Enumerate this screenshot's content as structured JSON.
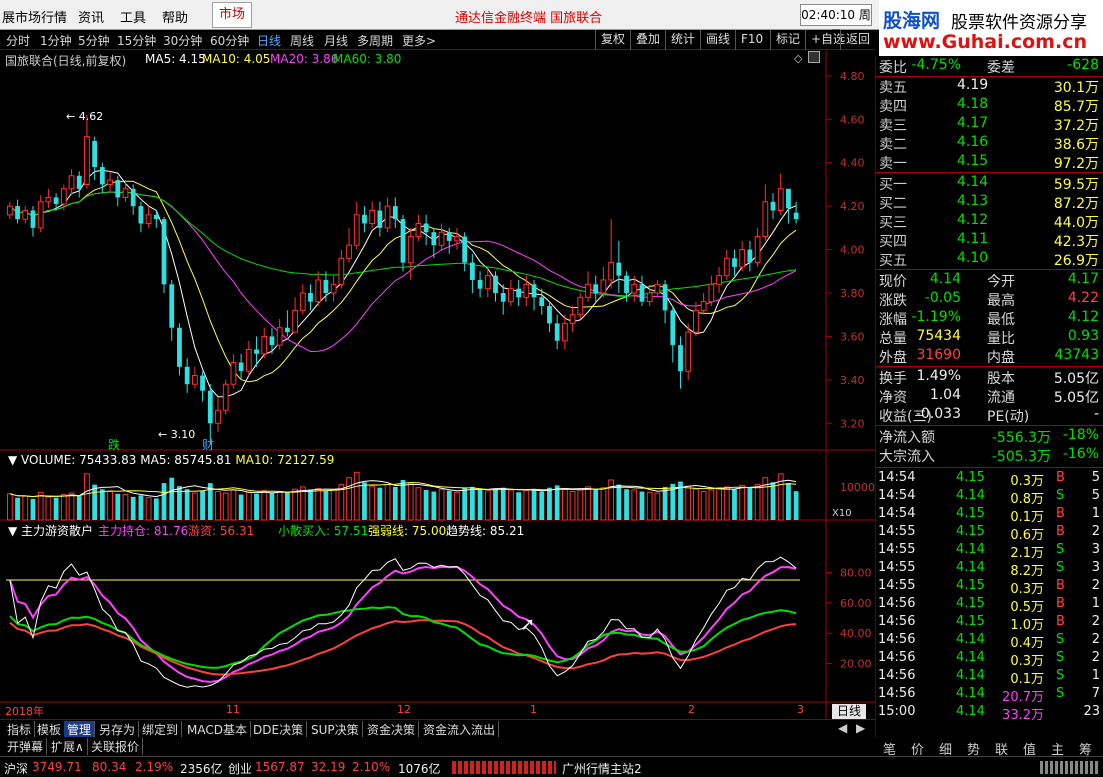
{
  "menubar": {
    "items": [
      "展市场行情",
      "资讯",
      "工具",
      "帮助"
    ],
    "market_tab": "市场",
    "center_title": "通达信金融终端 国旅联合",
    "clock": "02:40:10 周日"
  },
  "brand": {
    "name": "股海网",
    "slogan": "股票软件资源分享",
    "url": "www.Guhai.com.cn"
  },
  "toolbar": {
    "periods": [
      "分时",
      "1分钟",
      "5分钟",
      "15分钟",
      "30分钟",
      "60分钟",
      "日线",
      "周线",
      "月线",
      "多周期",
      "更多>"
    ],
    "active_period": "日线",
    "actions": [
      "复权",
      "叠加",
      "统计",
      "画线",
      "F10",
      "标记",
      "+自选",
      "返回"
    ]
  },
  "main_chart": {
    "title": "国旅联合(日线,前复权)",
    "ma_labels": [
      "MA5: 4.15",
      "MA10: 4.05",
      "MA20: 3.86",
      "MA60: 3.80"
    ],
    "ma_colors": [
      "#ffffff",
      "#ffff40",
      "#ff40ff",
      "#00e000"
    ],
    "high_label": "4.62",
    "low_label": "3.10",
    "marks": [
      "跌",
      "财"
    ],
    "price_axis": [
      "4.80",
      "4.60",
      "4.40",
      "4.20",
      "4.00",
      "3.80",
      "3.60",
      "3.40",
      "3.20"
    ]
  },
  "volume_panel": {
    "title": "VOLUME: 75433.83",
    "ma5": "MA5: 85745.81",
    "ma10": "MA10: 72127.59",
    "axis_label": "10000",
    "unit": "X10"
  },
  "indicator_panel": {
    "name": "主力游资散户",
    "lines": [
      "主力持仓: 81.76",
      "游资: 56.31",
      "小散买入: 57.51",
      "强弱线: 75.00",
      "趋势线: 85.21"
    ],
    "line_colors": [
      "#ff40ff",
      "#ff4040",
      "#00e000",
      "#ffff40",
      "#ffffff"
    ],
    "axis": [
      "80.00",
      "60.00",
      "40.00",
      "20.00"
    ]
  },
  "date_axis": [
    "2018年",
    "11",
    "12",
    "1",
    "2",
    "3"
  ],
  "bottom_tabs": [
    "指标",
    "模板",
    "管理",
    "另存为",
    "绑定到",
    "MACD基本",
    "DDE决策",
    "SUP决策",
    "资金决策",
    "资金流入流出"
  ],
  "bottom_tabs_active": "管理",
  "day_tab": "日线",
  "bottom_tabs2": [
    "开弹幕",
    "扩展∧",
    "关联报价"
  ],
  "side": {
    "weibi": {
      "label": "委比",
      "value": "-4.75%",
      "label2": "委差",
      "value2": "-628"
    },
    "asks": [
      {
        "label": "卖五",
        "price": "4.19",
        "qty": "30.1万"
      },
      {
        "label": "卖四",
        "price": "4.18",
        "qty": "85.7万"
      },
      {
        "label": "卖三",
        "price": "4.17",
        "qty": "37.2万"
      },
      {
        "label": "卖二",
        "price": "4.16",
        "qty": "38.6万"
      },
      {
        "label": "卖一",
        "price": "4.15",
        "qty": "97.2万"
      }
    ],
    "bids": [
      {
        "label": "买一",
        "price": "4.14",
        "qty": "59.5万"
      },
      {
        "label": "买二",
        "price": "4.13",
        "qty": "87.2万"
      },
      {
        "label": "买三",
        "price": "4.12",
        "qty": "44.0万"
      },
      {
        "label": "买四",
        "price": "4.11",
        "qty": "42.3万"
      },
      {
        "label": "买五",
        "price": "4.10",
        "qty": "26.9万"
      }
    ],
    "quote": [
      {
        "l": "现价",
        "v": "4.14",
        "l2": "今开",
        "v2": "4.17",
        "c": "grn",
        "c2": "grn"
      },
      {
        "l": "涨跌",
        "v": "-0.05",
        "l2": "最高",
        "v2": "4.22",
        "c": "grn",
        "c2": "red"
      },
      {
        "l": "涨幅",
        "v": "-1.19%",
        "l2": "最低",
        "v2": "4.12",
        "c": "grn",
        "c2": "grn"
      },
      {
        "l": "总量",
        "v": "75434",
        "l2": "量比",
        "v2": "0.93",
        "c": "yel",
        "c2": "grn"
      },
      {
        "l": "外盘",
        "v": "31690",
        "l2": "内盘",
        "v2": "43743",
        "c": "red",
        "c2": "grn"
      }
    ],
    "stats": [
      {
        "l": "换手",
        "v": "1.49%",
        "l2": "股本",
        "v2": "5.05亿"
      },
      {
        "l": "净资",
        "v": "1.04",
        "l2": "流通",
        "v2": "5.05亿"
      },
      {
        "l": "收益(三)",
        "v": "-0.033",
        "l2": "PE(动)",
        "v2": "-"
      }
    ],
    "flows": [
      {
        "l": "净流入额",
        "v": "-556.3万",
        "p": "-18%"
      },
      {
        "l": "大宗流入",
        "v": "-505.3万",
        "p": "-16%"
      }
    ],
    "ticks": [
      {
        "t": "14:54",
        "p": "4.15",
        "q": "0.3万",
        "s": "B",
        "n": "5"
      },
      {
        "t": "14:54",
        "p": "4.14",
        "q": "0.8万",
        "s": "S",
        "n": "5"
      },
      {
        "t": "14:54",
        "p": "4.15",
        "q": "0.1万",
        "s": "B",
        "n": "1"
      },
      {
        "t": "14:55",
        "p": "4.15",
        "q": "0.6万",
        "s": "B",
        "n": "2"
      },
      {
        "t": "14:55",
        "p": "4.14",
        "q": "2.1万",
        "s": "S",
        "n": "3"
      },
      {
        "t": "14:55",
        "p": "4.14",
        "q": "8.2万",
        "s": "S",
        "n": "3"
      },
      {
        "t": "14:55",
        "p": "4.15",
        "q": "0.3万",
        "s": "B",
        "n": "2"
      },
      {
        "t": "14:56",
        "p": "4.15",
        "q": "0.5万",
        "s": "B",
        "n": "1"
      },
      {
        "t": "14:56",
        "p": "4.15",
        "q": "1.0万",
        "s": "B",
        "n": "2"
      },
      {
        "t": "14:56",
        "p": "4.14",
        "q": "0.4万",
        "s": "S",
        "n": "2"
      },
      {
        "t": "14:56",
        "p": "4.14",
        "q": "0.3万",
        "s": "S",
        "n": "2"
      },
      {
        "t": "14:56",
        "p": "4.14",
        "q": "0.1万",
        "s": "S",
        "n": "1"
      },
      {
        "t": "14:56",
        "p": "4.14",
        "q": "20.7万",
        "s": "S",
        "n": "7"
      },
      {
        "t": "15:00",
        "p": "4.14",
        "q": "33.2万",
        "s": "",
        "n": "23"
      }
    ],
    "tabs": [
      "笔",
      "价",
      "细",
      "势",
      "联",
      "值",
      "主",
      "筹"
    ]
  },
  "status": {
    "sh_name": "沪深",
    "sh_index": "3749.71",
    "sh_chg": "80.34",
    "sh_pct": "2.19%",
    "sh_amt": "2356亿",
    "cy_name": "创业",
    "cy_index": "1567.87",
    "cy_chg": "32.19",
    "cy_pct": "2.10%",
    "cy_amt": "1076亿",
    "server": "广州行情主站2"
  },
  "chart_data": {
    "type": "candlestick",
    "price_range": [
      3.1,
      4.85
    ],
    "candles": [
      [
        4.16,
        4.2,
        4.22,
        4.14
      ],
      [
        4.2,
        4.14,
        4.23,
        4.12
      ],
      [
        4.14,
        4.18,
        4.2,
        4.12
      ],
      [
        4.18,
        4.1,
        4.2,
        4.06
      ],
      [
        4.1,
        4.22,
        4.25,
        4.08
      ],
      [
        4.22,
        4.24,
        4.28,
        4.19
      ],
      [
        4.24,
        4.21,
        4.26,
        4.18
      ],
      [
        4.21,
        4.28,
        4.3,
        4.18
      ],
      [
        4.28,
        4.34,
        4.37,
        4.25
      ],
      [
        4.34,
        4.28,
        4.36,
        4.24
      ],
      [
        4.3,
        4.52,
        4.62,
        4.28
      ],
      [
        4.5,
        4.38,
        4.52,
        4.32
      ],
      [
        4.38,
        4.3,
        4.4,
        4.26
      ],
      [
        4.3,
        4.32,
        4.36,
        4.26
      ],
      [
        4.32,
        4.24,
        4.34,
        4.2
      ],
      [
        4.24,
        4.28,
        4.32,
        4.22
      ],
      [
        4.28,
        4.2,
        4.3,
        4.16
      ],
      [
        4.2,
        4.12,
        4.22,
        4.08
      ],
      [
        4.12,
        4.16,
        4.2,
        4.1
      ],
      [
        4.16,
        4.14,
        4.18,
        4.1
      ],
      [
        4.14,
        3.84,
        4.15,
        3.8
      ],
      [
        3.84,
        3.64,
        3.86,
        3.58
      ],
      [
        3.64,
        3.46,
        3.66,
        3.42
      ],
      [
        3.46,
        3.38,
        3.5,
        3.34
      ],
      [
        3.38,
        3.42,
        3.46,
        3.36
      ],
      [
        3.42,
        3.35,
        3.44,
        3.3
      ],
      [
        3.35,
        3.2,
        3.38,
        3.1
      ],
      [
        3.2,
        3.26,
        3.32,
        3.16
      ],
      [
        3.26,
        3.38,
        3.4,
        3.24
      ],
      [
        3.38,
        3.48,
        3.52,
        3.36
      ],
      [
        3.48,
        3.44,
        3.52,
        3.4
      ],
      [
        3.44,
        3.54,
        3.58,
        3.42
      ],
      [
        3.54,
        3.52,
        3.6,
        3.46
      ],
      [
        3.52,
        3.6,
        3.64,
        3.5
      ],
      [
        3.6,
        3.56,
        3.64,
        3.52
      ],
      [
        3.56,
        3.64,
        3.68,
        3.54
      ],
      [
        3.64,
        3.62,
        3.72,
        3.6
      ],
      [
        3.62,
        3.72,
        3.78,
        3.62
      ],
      [
        3.72,
        3.8,
        3.84,
        3.7
      ],
      [
        3.8,
        3.76,
        3.84,
        3.72
      ],
      [
        3.76,
        3.86,
        3.9,
        3.74
      ],
      [
        3.86,
        3.8,
        3.9,
        3.76
      ],
      [
        3.8,
        3.84,
        3.88,
        3.76
      ],
      [
        3.84,
        3.96,
        4.0,
        3.82
      ],
      [
        3.96,
        4.02,
        4.1,
        3.94
      ],
      [
        4.02,
        4.16,
        4.22,
        4.0
      ],
      [
        4.16,
        4.12,
        4.2,
        4.08
      ],
      [
        4.12,
        4.18,
        4.22,
        4.1
      ],
      [
        4.18,
        4.1,
        4.22,
        4.06
      ],
      [
        4.1,
        4.2,
        4.24,
        4.08
      ],
      [
        4.2,
        4.14,
        4.24,
        4.1
      ],
      [
        4.14,
        3.94,
        4.16,
        3.9
      ],
      [
        3.94,
        4.06,
        4.1,
        3.86
      ],
      [
        4.06,
        4.12,
        4.16,
        4.04
      ],
      [
        4.12,
        4.08,
        4.16,
        4.02
      ],
      [
        4.08,
        4.02,
        4.1,
        3.96
      ],
      [
        4.02,
        4.08,
        4.12,
        4.0
      ],
      [
        4.08,
        4.04,
        4.1,
        3.98
      ],
      [
        4.04,
        4.06,
        4.1,
        4.0
      ],
      [
        4.06,
        3.94,
        4.08,
        3.9
      ],
      [
        3.94,
        3.86,
        3.98,
        3.8
      ],
      [
        3.86,
        3.82,
        3.9,
        3.78
      ],
      [
        3.82,
        3.88,
        3.92,
        3.78
      ],
      [
        3.88,
        3.8,
        3.9,
        3.76
      ],
      [
        3.8,
        3.76,
        3.84,
        3.7
      ],
      [
        3.76,
        3.82,
        3.86,
        3.74
      ],
      [
        3.82,
        3.78,
        3.86,
        3.74
      ],
      [
        3.78,
        3.84,
        3.88,
        3.74
      ],
      [
        3.84,
        3.78,
        3.86,
        3.72
      ],
      [
        3.78,
        3.74,
        3.82,
        3.7
      ],
      [
        3.74,
        3.66,
        3.76,
        3.62
      ],
      [
        3.66,
        3.58,
        3.7,
        3.54
      ],
      [
        3.58,
        3.66,
        3.7,
        3.54
      ],
      [
        3.66,
        3.7,
        3.74,
        3.62
      ],
      [
        3.7,
        3.78,
        3.8,
        3.68
      ],
      [
        3.78,
        3.84,
        3.9,
        3.76
      ],
      [
        3.84,
        3.8,
        3.88,
        3.76
      ],
      [
        3.8,
        3.86,
        3.92,
        3.78
      ],
      [
        3.86,
        3.94,
        4.14,
        3.82
      ],
      [
        3.94,
        3.88,
        4.04,
        3.8
      ],
      [
        3.88,
        3.8,
        3.9,
        3.76
      ],
      [
        3.8,
        3.84,
        3.88,
        3.76
      ],
      [
        3.84,
        3.76,
        3.88,
        3.74
      ],
      [
        3.76,
        3.8,
        3.84,
        3.74
      ],
      [
        3.8,
        3.84,
        3.86,
        3.78
      ],
      [
        3.84,
        3.72,
        3.86,
        3.66
      ],
      [
        3.72,
        3.56,
        3.74,
        3.48
      ],
      [
        3.56,
        3.44,
        3.6,
        3.36
      ],
      [
        3.44,
        3.62,
        3.66,
        3.4
      ],
      [
        3.62,
        3.72,
        3.76,
        3.6
      ],
      [
        3.72,
        3.76,
        3.8,
        3.7
      ],
      [
        3.76,
        3.84,
        3.88,
        3.74
      ],
      [
        3.84,
        3.88,
        3.92,
        3.8
      ],
      [
        3.88,
        3.96,
        4.0,
        3.86
      ],
      [
        3.96,
        3.92,
        4.0,
        3.88
      ],
      [
        3.92,
        4.0,
        4.04,
        3.9
      ],
      [
        4.0,
        3.94,
        4.04,
        3.9
      ],
      [
        3.94,
        4.06,
        4.1,
        3.92
      ],
      [
        4.06,
        4.22,
        4.3,
        4.04
      ],
      [
        4.22,
        4.18,
        4.26,
        4.14
      ],
      [
        4.18,
        4.28,
        4.35,
        4.16
      ],
      [
        4.28,
        4.19,
        4.22,
        4.12
      ],
      [
        4.17,
        4.14,
        4.22,
        4.12
      ]
    ],
    "volumes": [
      68,
      58,
      62,
      55,
      72,
      60,
      58,
      66,
      70,
      62,
      120,
      92,
      80,
      74,
      68,
      66,
      60,
      64,
      58,
      56,
      96,
      110,
      88,
      80,
      70,
      76,
      96,
      74,
      70,
      78,
      66,
      72,
      68,
      76,
      70,
      74,
      72,
      80,
      86,
      78,
      82,
      76,
      78,
      92,
      110,
      124,
      98,
      88,
      84,
      92,
      86,
      104,
      96,
      84,
      78,
      74,
      80,
      76,
      72,
      84,
      86,
      80,
      76,
      82,
      84,
      78,
      72,
      76,
      80,
      74,
      84,
      90,
      82,
      74,
      78,
      86,
      80,
      84,
      104,
      92,
      80,
      78,
      74,
      72,
      70,
      86,
      94,
      100,
      88,
      80,
      74,
      78,
      84,
      86,
      80,
      90,
      84,
      92,
      110,
      98,
      120,
      96,
      75
    ]
  }
}
